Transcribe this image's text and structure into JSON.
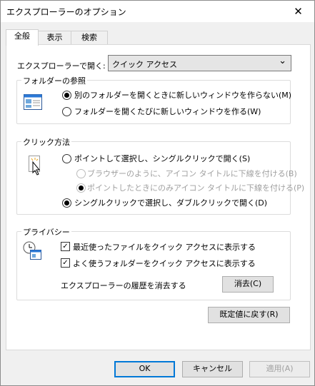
{
  "window": {
    "title": "エクスプローラーのオプション",
    "close_glyph": "✕"
  },
  "tabs": [
    {
      "label": "全般"
    },
    {
      "label": "表示"
    },
    {
      "label": "検索"
    }
  ],
  "open_explorer": {
    "label": "エクスプローラーで開く:",
    "value": "クイック アクセス",
    "chevron": "⌄"
  },
  "browse_folders": {
    "title": "フォルダーの参照",
    "option_same_window": "別のフォルダーを開くときに新しいウィンドウを作らない(M)",
    "option_new_window": "フォルダーを開くたびに新しいウィンドウを作る(W)",
    "selected": "same_window"
  },
  "click_items": {
    "title": "クリック方法",
    "option_single": "ポイントして選択し、シングルクリックで開く(S)",
    "sub_browser": "ブラウザーのように、アイコン タイトルに下線を付ける(B)",
    "sub_point": "ポイントしたときにのみアイコン タイトルに下線を付ける(P)",
    "option_double": "シングルクリックで選択し、ダブルクリックで開く(D)",
    "selected": "double"
  },
  "privacy": {
    "title": "プライバシー",
    "show_recent": "最近使ったファイルをクイック アクセスに表示する",
    "show_frequent": "よく使うフォルダーをクイック アクセスに表示する",
    "clear_label": "エクスプローラーの履歴を消去する",
    "clear_button": "消去(C)",
    "check_glyph": "✓"
  },
  "restore_defaults": "既定値に戻す(R)",
  "buttons": {
    "ok": "OK",
    "cancel": "キャンセル",
    "apply": "適用(A)"
  }
}
